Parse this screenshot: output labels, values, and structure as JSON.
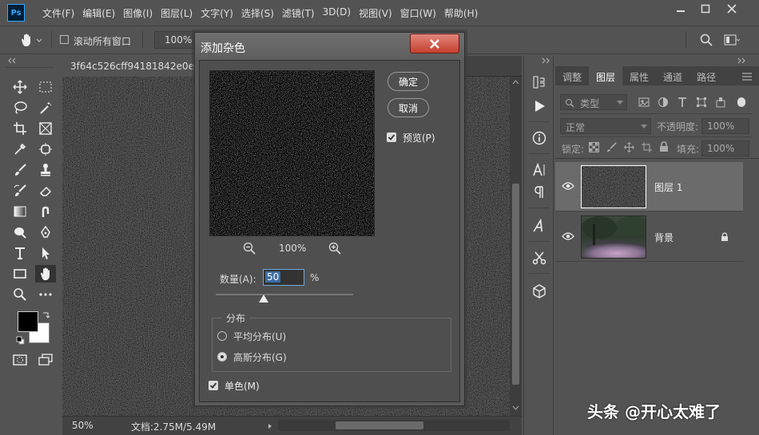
{
  "menu": {
    "logo": "Ps",
    "items": [
      "文件(F)",
      "编辑(E)",
      "图像(I)",
      "图层(L)",
      "文字(Y)",
      "选择(S)",
      "滤镜(T)",
      "3D(D)",
      "视图(V)",
      "窗口(W)",
      "帮助(H)"
    ]
  },
  "options": {
    "scroll_all_windows": "滚动所有窗口",
    "zoom_value": "100%"
  },
  "document": {
    "tab_title": "3f64c526cff94181842e0eeb",
    "zoom": "50%",
    "doc_info": "文档:2.75M/5.49M"
  },
  "dialog": {
    "title": "添加杂色",
    "ok": "确定",
    "cancel": "取消",
    "preview_label": "预览(P)",
    "preview_zoom": "100%",
    "amount_label": "数量(A):",
    "amount_value": "50",
    "amount_unit": "%",
    "amount_fraction": 0.35,
    "distribution_title": "分布",
    "uniform_label": "平均分布(U)",
    "gaussian_label": "高斯分布(G)",
    "selected_distribution": "gaussian",
    "mono_label": "单色(M)"
  },
  "layers_panel": {
    "tabs": [
      "调整",
      "图层",
      "属性",
      "通道",
      "路径"
    ],
    "active_tab": "图层",
    "filter_kind": "类型",
    "blend_mode": "正常",
    "opacity_label": "不透明度:",
    "opacity_value": "100%",
    "lock_label": "锁定:",
    "fill_label": "填充:",
    "fill_value": "100%",
    "layers": [
      {
        "name": "图层 1",
        "selected": true,
        "locked": false
      },
      {
        "name": "背景",
        "selected": false,
        "locked": true
      }
    ]
  },
  "watermark": "头条 @开心太难了",
  "colors": {
    "accent": "#31a8ff",
    "foreground": "#000000",
    "background": "#ffffff"
  }
}
